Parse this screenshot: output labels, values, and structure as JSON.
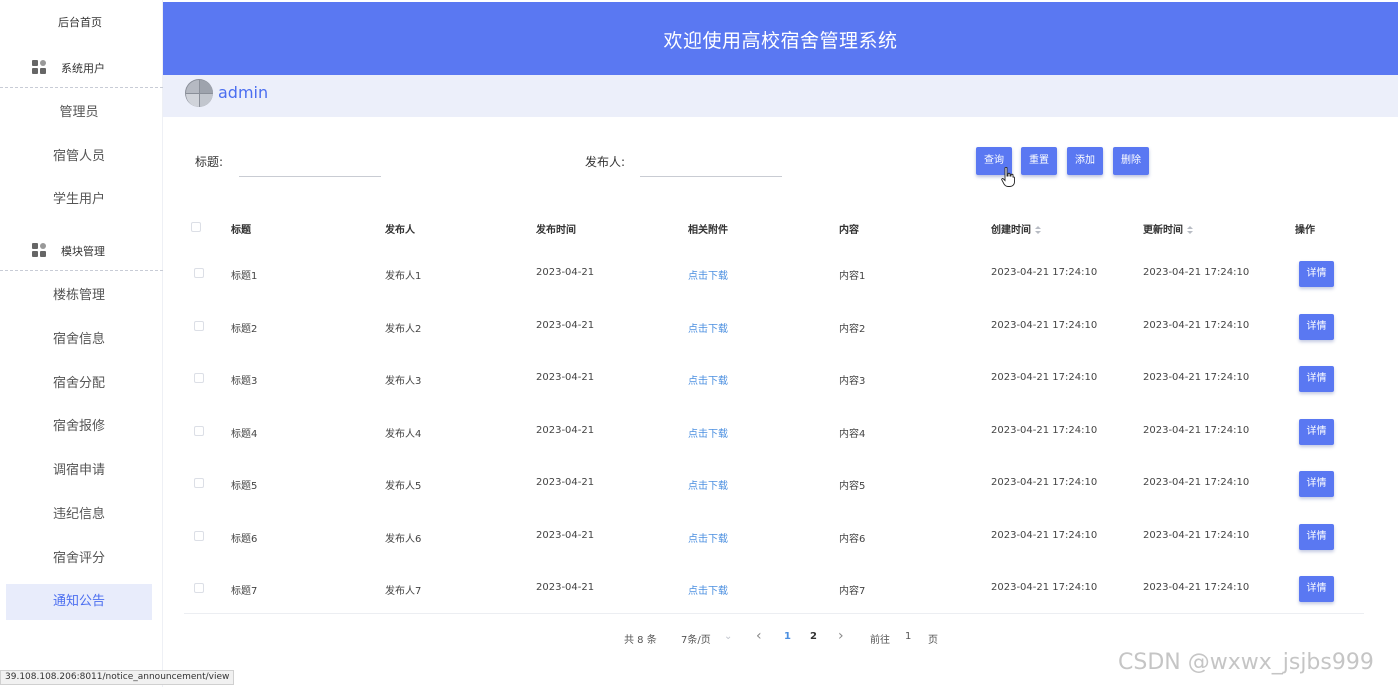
{
  "sidebar": {
    "home": "后台首页",
    "groups": [
      {
        "label": "系统用户",
        "icon": "grid-icon",
        "items": [
          "管理员",
          "宿管人员",
          "学生用户"
        ]
      },
      {
        "label": "模块管理",
        "icon": "grid-icon",
        "items": [
          "楼栋管理",
          "宿舍信息",
          "宿舍分配",
          "宿舍报修",
          "调宿申请",
          "违纪信息",
          "宿舍评分",
          "通知公告"
        ]
      }
    ],
    "active_item": "通知公告"
  },
  "header": {
    "title": "欢迎使用高校宿舍管理系统"
  },
  "user": {
    "name": "admin"
  },
  "filters": {
    "title_label": "标题:",
    "title_value": "",
    "publisher_label": "发布人:",
    "publisher_value": ""
  },
  "actions": {
    "query": "查询",
    "reset": "重置",
    "add": "添加",
    "delete": "删除"
  },
  "table": {
    "columns": [
      "标题",
      "发布人",
      "发布时间",
      "相关附件",
      "内容",
      "创建时间",
      "更新时间",
      "操作"
    ],
    "sortable_columns": [
      "创建时间",
      "更新时间"
    ],
    "rows": [
      {
        "title": "标题1",
        "publisher": "发布人1",
        "date": "2023-04-21",
        "attachment": "点击下载",
        "content": "内容1",
        "created": "2023-04-21 17:24:10",
        "updated": "2023-04-21 17:24:10",
        "action": "详情"
      },
      {
        "title": "标题2",
        "publisher": "发布人2",
        "date": "2023-04-21",
        "attachment": "点击下载",
        "content": "内容2",
        "created": "2023-04-21 17:24:10",
        "updated": "2023-04-21 17:24:10",
        "action": "详情"
      },
      {
        "title": "标题3",
        "publisher": "发布人3",
        "date": "2023-04-21",
        "attachment": "点击下载",
        "content": "内容3",
        "created": "2023-04-21 17:24:10",
        "updated": "2023-04-21 17:24:10",
        "action": "详情"
      },
      {
        "title": "标题4",
        "publisher": "发布人4",
        "date": "2023-04-21",
        "attachment": "点击下载",
        "content": "内容4",
        "created": "2023-04-21 17:24:10",
        "updated": "2023-04-21 17:24:10",
        "action": "详情"
      },
      {
        "title": "标题5",
        "publisher": "发布人5",
        "date": "2023-04-21",
        "attachment": "点击下载",
        "content": "内容5",
        "created": "2023-04-21 17:24:10",
        "updated": "2023-04-21 17:24:10",
        "action": "详情"
      },
      {
        "title": "标题6",
        "publisher": "发布人6",
        "date": "2023-04-21",
        "attachment": "点击下载",
        "content": "内容6",
        "created": "2023-04-21 17:24:10",
        "updated": "2023-04-21 17:24:10",
        "action": "详情"
      },
      {
        "title": "标题7",
        "publisher": "发布人7",
        "date": "2023-04-21",
        "attachment": "点击下载",
        "content": "内容7",
        "created": "2023-04-21 17:24:10",
        "updated": "2023-04-21 17:24:10",
        "action": "详情"
      }
    ]
  },
  "pagination": {
    "total": "共 8 条",
    "page_size": "7条/页",
    "prev": "‹",
    "pages": [
      "1",
      "2"
    ],
    "current_page": "1",
    "next": "›",
    "goto_label": "前往",
    "goto_value": "1",
    "goto_suffix": "页"
  },
  "status_url": "39.108.108.206:8011/notice_announcement/view",
  "watermark": "CSDN @wxwx_jsjbs999",
  "colors": {
    "primary": "#5a78f2",
    "link": "#4b8fe0",
    "active_bg": "#e8ecfb",
    "userbar_bg": "#eceffa"
  }
}
